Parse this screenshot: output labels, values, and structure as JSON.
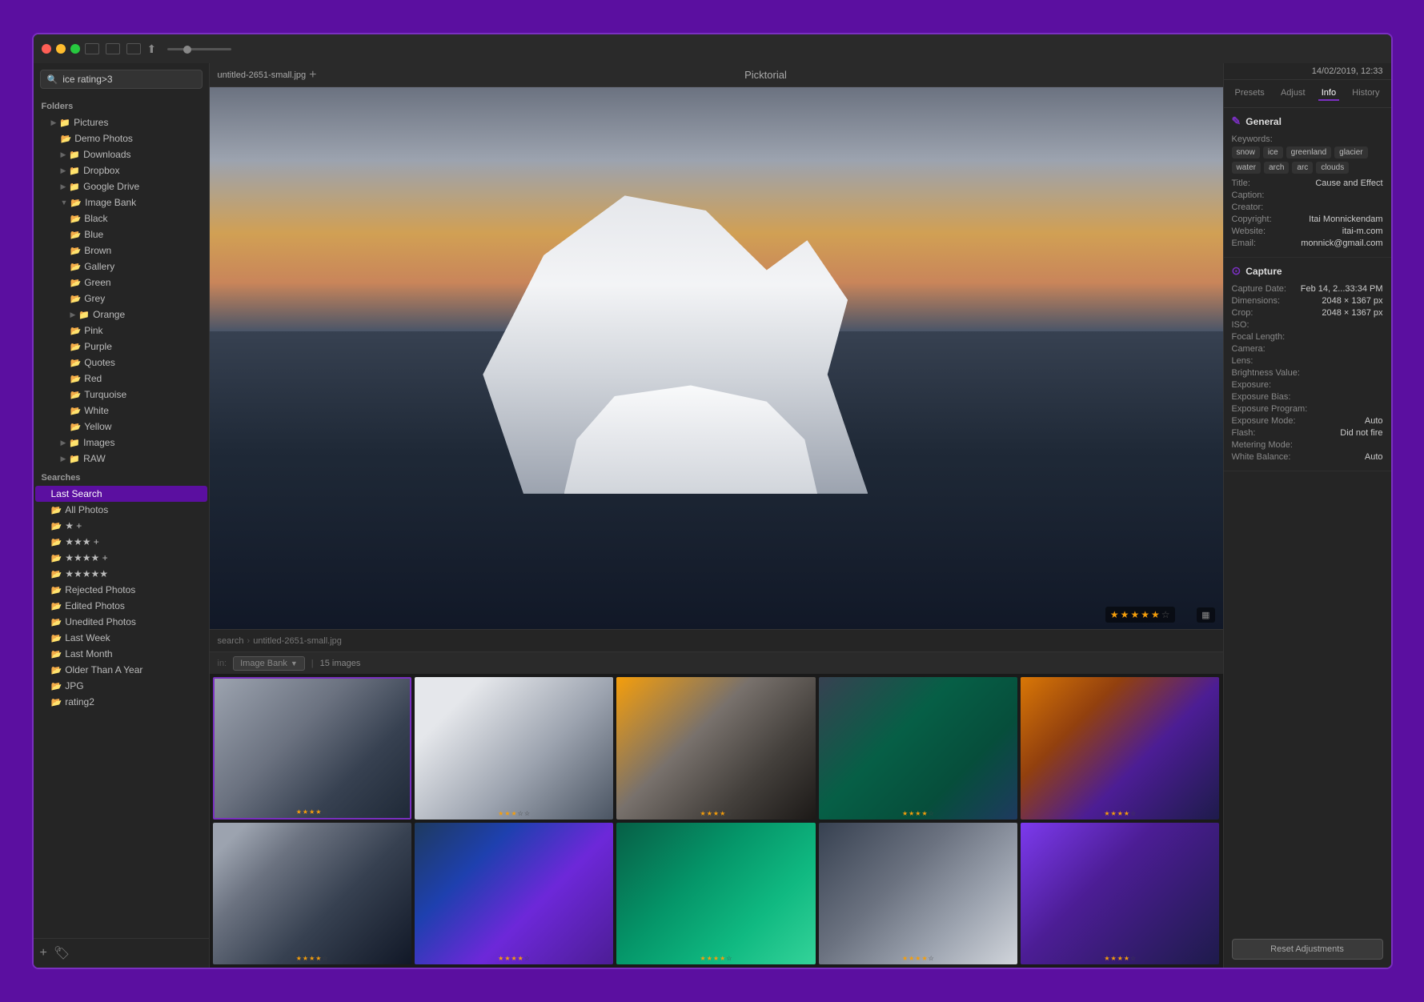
{
  "app": {
    "title": "Picktorial",
    "date_time": "14/02/2019, 12:33"
  },
  "titlebar": {
    "icon1": "⊞",
    "icon2": "⊟",
    "icon3": "⊠",
    "share_icon": "↑"
  },
  "search": {
    "placeholder": "ice rating>3",
    "value": "ice rating>3"
  },
  "sidebar": {
    "folders_label": "Folders",
    "searches_label": "Searches",
    "folders": [
      {
        "id": "pictures",
        "label": "Pictures",
        "indent": 1,
        "has_arrow": true
      },
      {
        "id": "demo-photos",
        "label": "Demo Photos",
        "indent": 2,
        "has_arrow": false
      },
      {
        "id": "downloads",
        "label": "Downloads",
        "indent": 2,
        "has_arrow": true
      },
      {
        "id": "dropbox",
        "label": "Dropbox",
        "indent": 2,
        "has_arrow": true
      },
      {
        "id": "google-drive",
        "label": "Google Drive",
        "indent": 2,
        "has_arrow": true
      },
      {
        "id": "image-bank",
        "label": "Image Bank",
        "indent": 2,
        "has_arrow": true,
        "expanded": true
      },
      {
        "id": "black",
        "label": "Black",
        "indent": 3,
        "has_arrow": false
      },
      {
        "id": "blue",
        "label": "Blue",
        "indent": 3,
        "has_arrow": false
      },
      {
        "id": "brown",
        "label": "Brown",
        "indent": 3,
        "has_arrow": false
      },
      {
        "id": "gallery",
        "label": "Gallery",
        "indent": 3,
        "has_arrow": false
      },
      {
        "id": "green",
        "label": "Green",
        "indent": 3,
        "has_arrow": false
      },
      {
        "id": "grey",
        "label": "Grey",
        "indent": 3,
        "has_arrow": false
      },
      {
        "id": "orange",
        "label": "Orange",
        "indent": 3,
        "has_arrow": true
      },
      {
        "id": "pink",
        "label": "Pink",
        "indent": 3,
        "has_arrow": false
      },
      {
        "id": "purple",
        "label": "Purple",
        "indent": 3,
        "has_arrow": false
      },
      {
        "id": "quotes",
        "label": "Quotes",
        "indent": 3,
        "has_arrow": false
      },
      {
        "id": "red",
        "label": "Red",
        "indent": 3,
        "has_arrow": false
      },
      {
        "id": "turquoise",
        "label": "Turquoise",
        "indent": 3,
        "has_arrow": false
      },
      {
        "id": "white",
        "label": "White",
        "indent": 3,
        "has_arrow": false
      },
      {
        "id": "yellow",
        "label": "Yellow",
        "indent": 3,
        "has_arrow": false
      },
      {
        "id": "images",
        "label": "Images",
        "indent": 2,
        "has_arrow": true
      },
      {
        "id": "raw",
        "label": "RAW",
        "indent": 2,
        "has_arrow": true
      }
    ],
    "searches": [
      {
        "id": "last-search",
        "label": "Last Search",
        "indent": 1,
        "active": true
      },
      {
        "id": "all-photos",
        "label": "All Photos",
        "indent": 1
      },
      {
        "id": "2star",
        "label": "★ +",
        "indent": 1
      },
      {
        "id": "3star",
        "label": "★★★ +",
        "indent": 1
      },
      {
        "id": "4star",
        "label": "★★★★ +",
        "indent": 1
      },
      {
        "id": "5star",
        "label": "★★★★★",
        "indent": 1
      },
      {
        "id": "rejected",
        "label": "Rejected Photos",
        "indent": 1
      },
      {
        "id": "edited",
        "label": "Edited Photos",
        "indent": 1
      },
      {
        "id": "unedited",
        "label": "Unedited Photos",
        "indent": 1
      },
      {
        "id": "last-week",
        "label": "Last Week",
        "indent": 1
      },
      {
        "id": "last-month",
        "label": "Last Month",
        "indent": 1
      },
      {
        "id": "older-year",
        "label": "Older Than A Year",
        "indent": 1
      },
      {
        "id": "jpg",
        "label": "JPG",
        "indent": 1
      },
      {
        "id": "rating2",
        "label": "rating2",
        "indent": 1
      }
    ],
    "add_label": "+",
    "tag_label": "🏷"
  },
  "center": {
    "tab_filename": "untitled-2651-small.jpg",
    "add_tab": "+",
    "breadcrumb": [
      {
        "label": "search"
      },
      {
        "label": "untitled-2651-small.jpg"
      }
    ],
    "location": "Image Bank",
    "image_count": "15 images",
    "rating_stars": [
      "★",
      "★",
      "★",
      "★",
      "★",
      "☆"
    ],
    "thumbnails": [
      {
        "id": 1,
        "class": "thumb-1",
        "selected": true,
        "stars": 4
      },
      {
        "id": 2,
        "class": "thumb-2",
        "selected": false,
        "stars": 3
      },
      {
        "id": 3,
        "class": "thumb-3",
        "selected": false,
        "stars": 4
      },
      {
        "id": 4,
        "class": "thumb-4",
        "selected": false,
        "stars": 4
      },
      {
        "id": 5,
        "class": "thumb-5",
        "selected": false,
        "stars": 4
      },
      {
        "id": 6,
        "class": "thumb-6",
        "selected": false,
        "stars": 4
      },
      {
        "id": 7,
        "class": "thumb-7",
        "selected": false,
        "stars": 4
      },
      {
        "id": 8,
        "class": "thumb-8",
        "selected": false,
        "stars": 4
      },
      {
        "id": 9,
        "class": "thumb-9",
        "selected": false,
        "stars": 4
      },
      {
        "id": 10,
        "class": "thumb-10",
        "selected": false,
        "stars": 4
      }
    ]
  },
  "right_panel": {
    "date_time": "14/02/2019, 12:33",
    "tabs": [
      "Presets",
      "Adjust",
      "Info",
      "History"
    ],
    "active_tab": "Info",
    "general_section": {
      "title": "General",
      "keywords_label": "Keywords:",
      "keywords": [
        "snow",
        "ice",
        "greenland",
        "glacier",
        "water",
        "arch",
        "arc",
        "clouds"
      ],
      "title_label": "Title:",
      "title_value": "Cause and  Effect",
      "caption_label": "Caption:",
      "caption_value": "",
      "creator_label": "Creator:",
      "creator_value": "",
      "copyright_label": "Copyright:",
      "copyright_value": "Itai Monnickendam",
      "website_label": "Website:",
      "website_value": "itai-m.com",
      "email_label": "Email:",
      "email_value": "monnick@gmail.com"
    },
    "capture_section": {
      "title": "Capture",
      "capture_date_label": "Capture Date:",
      "capture_date_value": "Feb 14, 2...33:34 PM",
      "dimensions_label": "Dimensions:",
      "dimensions_value": "2048 × 1367 px",
      "crop_label": "Crop:",
      "crop_value": "2048 × 1367 px",
      "iso_label": "ISO:",
      "iso_value": "",
      "focal_length_label": "Focal Length:",
      "focal_length_value": "",
      "camera_label": "Camera:",
      "camera_value": "",
      "lens_label": "Lens:",
      "lens_value": "",
      "brightness_label": "Brightness Value:",
      "brightness_value": "",
      "exposure_label": "Exposure:",
      "exposure_value": "",
      "exposure_bias_label": "Exposure Bias:",
      "exposure_bias_value": "",
      "exposure_program_label": "Exposure Program:",
      "exposure_program_value": "",
      "exposure_mode_label": "Exposure Mode:",
      "exposure_mode_value": "Auto",
      "flash_label": "Flash:",
      "flash_value": "Did not fire",
      "metering_mode_label": "Metering Mode:",
      "metering_mode_value": "",
      "white_balance_label": "White Balance:",
      "white_balance_value": "Auto"
    },
    "reset_button_label": "Reset Adjustments"
  }
}
